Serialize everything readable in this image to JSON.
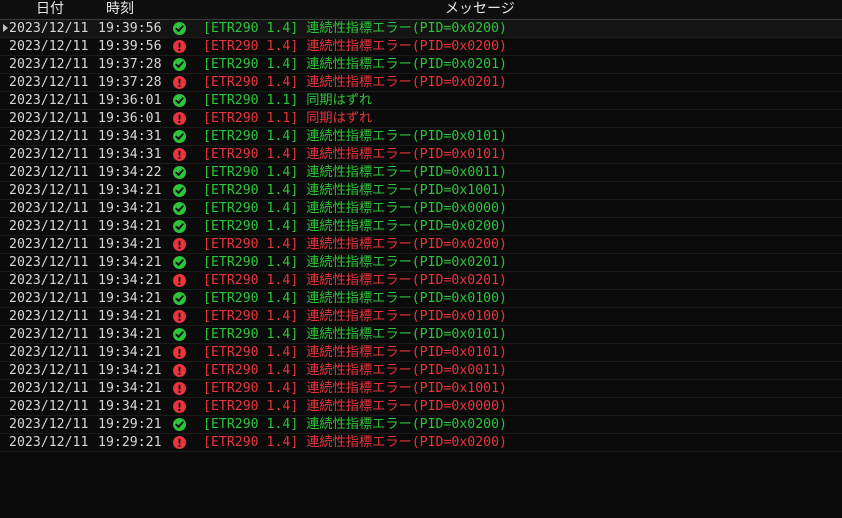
{
  "header": {
    "date": "日付",
    "time": "時刻",
    "message": "メッセージ"
  },
  "colors": {
    "ok": "#2ec43a",
    "err": "#e8353d"
  },
  "rows": [
    {
      "date": "2023/12/11",
      "time": "19:39:56",
      "status": "ok",
      "icon": "check-circle-icon",
      "message": "[ETR290 1.4] 連続性指標エラー(PID=0x0200)"
    },
    {
      "date": "2023/12/11",
      "time": "19:39:56",
      "status": "err",
      "icon": "exclamation-circle-icon",
      "message": "[ETR290 1.4] 連続性指標エラー(PID=0x0200)"
    },
    {
      "date": "2023/12/11",
      "time": "19:37:28",
      "status": "ok",
      "icon": "check-circle-icon",
      "message": "[ETR290 1.4] 連続性指標エラー(PID=0x0201)"
    },
    {
      "date": "2023/12/11",
      "time": "19:37:28",
      "status": "err",
      "icon": "exclamation-circle-icon",
      "message": "[ETR290 1.4] 連続性指標エラー(PID=0x0201)"
    },
    {
      "date": "2023/12/11",
      "time": "19:36:01",
      "status": "ok",
      "icon": "check-circle-icon",
      "message": "[ETR290 1.1] 同期はずれ"
    },
    {
      "date": "2023/12/11",
      "time": "19:36:01",
      "status": "err",
      "icon": "exclamation-circle-icon",
      "message": "[ETR290 1.1] 同期はずれ"
    },
    {
      "date": "2023/12/11",
      "time": "19:34:31",
      "status": "ok",
      "icon": "check-circle-icon",
      "message": "[ETR290 1.4] 連続性指標エラー(PID=0x0101)"
    },
    {
      "date": "2023/12/11",
      "time": "19:34:31",
      "status": "err",
      "icon": "exclamation-circle-icon",
      "message": "[ETR290 1.4] 連続性指標エラー(PID=0x0101)"
    },
    {
      "date": "2023/12/11",
      "time": "19:34:22",
      "status": "ok",
      "icon": "check-circle-icon",
      "message": "[ETR290 1.4] 連続性指標エラー(PID=0x0011)"
    },
    {
      "date": "2023/12/11",
      "time": "19:34:21",
      "status": "ok",
      "icon": "check-circle-icon",
      "message": "[ETR290 1.4] 連続性指標エラー(PID=0x1001)"
    },
    {
      "date": "2023/12/11",
      "time": "19:34:21",
      "status": "ok",
      "icon": "check-circle-icon",
      "message": "[ETR290 1.4] 連続性指標エラー(PID=0x0000)"
    },
    {
      "date": "2023/12/11",
      "time": "19:34:21",
      "status": "ok",
      "icon": "check-circle-icon",
      "message": "[ETR290 1.4] 連続性指標エラー(PID=0x0200)"
    },
    {
      "date": "2023/12/11",
      "time": "19:34:21",
      "status": "err",
      "icon": "exclamation-circle-icon",
      "message": "[ETR290 1.4] 連続性指標エラー(PID=0x0200)"
    },
    {
      "date": "2023/12/11",
      "time": "19:34:21",
      "status": "ok",
      "icon": "check-circle-icon",
      "message": "[ETR290 1.4] 連続性指標エラー(PID=0x0201)"
    },
    {
      "date": "2023/12/11",
      "time": "19:34:21",
      "status": "err",
      "icon": "exclamation-circle-icon",
      "message": "[ETR290 1.4] 連続性指標エラー(PID=0x0201)"
    },
    {
      "date": "2023/12/11",
      "time": "19:34:21",
      "status": "ok",
      "icon": "check-circle-icon",
      "message": "[ETR290 1.4] 連続性指標エラー(PID=0x0100)"
    },
    {
      "date": "2023/12/11",
      "time": "19:34:21",
      "status": "err",
      "icon": "exclamation-circle-icon",
      "message": "[ETR290 1.4] 連続性指標エラー(PID=0x0100)"
    },
    {
      "date": "2023/12/11",
      "time": "19:34:21",
      "status": "ok",
      "icon": "check-circle-icon",
      "message": "[ETR290 1.4] 連続性指標エラー(PID=0x0101)"
    },
    {
      "date": "2023/12/11",
      "time": "19:34:21",
      "status": "err",
      "icon": "exclamation-circle-icon",
      "message": "[ETR290 1.4] 連続性指標エラー(PID=0x0101)"
    },
    {
      "date": "2023/12/11",
      "time": "19:34:21",
      "status": "err",
      "icon": "exclamation-circle-icon",
      "message": "[ETR290 1.4] 連続性指標エラー(PID=0x0011)"
    },
    {
      "date": "2023/12/11",
      "time": "19:34:21",
      "status": "err",
      "icon": "exclamation-circle-icon",
      "message": "[ETR290 1.4] 連続性指標エラー(PID=0x1001)"
    },
    {
      "date": "2023/12/11",
      "time": "19:34:21",
      "status": "err",
      "icon": "exclamation-circle-icon",
      "message": "[ETR290 1.4] 連続性指標エラー(PID=0x0000)"
    },
    {
      "date": "2023/12/11",
      "time": "19:29:21",
      "status": "ok",
      "icon": "check-circle-icon",
      "message": "[ETR290 1.4] 連続性指標エラー(PID=0x0200)"
    },
    {
      "date": "2023/12/11",
      "time": "19:29:21",
      "status": "err",
      "icon": "exclamation-circle-icon",
      "message": "[ETR290 1.4] 連続性指標エラー(PID=0x0200)"
    }
  ]
}
